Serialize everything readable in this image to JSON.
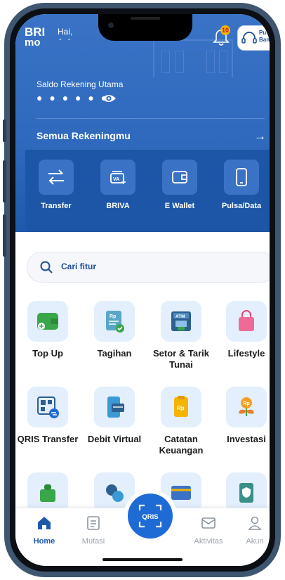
{
  "header": {
    "logo_top": "BRI",
    "logo_bottom": "mo",
    "greeting": "Hai,",
    "user_name": "- -",
    "notification_count": "10",
    "help_label_line1": "Pusa",
    "help_label_line2": "Bantu"
  },
  "balance": {
    "label": "Saldo Rekening Utama",
    "masked_value": "● ● ● ● ● ●",
    "all_accounts_label": "Semua Rekeningmu"
  },
  "quick_actions": [
    {
      "label": "Transfer",
      "icon": "transfer-arrows-icon"
    },
    {
      "label": "BRIVA",
      "icon": "briva-va-icon"
    },
    {
      "label": "E Wallet",
      "icon": "wallet-icon"
    },
    {
      "label": "Pulsa/Data",
      "icon": "phone-icon"
    }
  ],
  "search": {
    "placeholder": "Cari fitur"
  },
  "features": [
    {
      "label": "Top Up",
      "icon": "wallet-topup-icon"
    },
    {
      "label": "Tagihan",
      "icon": "bill-icon"
    },
    {
      "label": "Setor & Tarik Tunai",
      "icon": "atm-icon"
    },
    {
      "label": "Lifestyle",
      "icon": "shopping-bag-icon"
    },
    {
      "label": "QRIS Transfer",
      "icon": "qr-transfer-icon"
    },
    {
      "label": "Debit Virtual",
      "icon": "virtual-debit-icon"
    },
    {
      "label": "Catatan Keuangan",
      "icon": "finance-notes-icon"
    },
    {
      "label": "Investasi",
      "icon": "investment-icon"
    }
  ],
  "bottom_nav": {
    "home": "Home",
    "mutasi": "Mutasi",
    "qris": "QRIS",
    "aktivitas": "Aktivitas",
    "akun": "Akun"
  },
  "colors": {
    "primary": "#1e5aab",
    "header": "#3a73c6",
    "accent": "#f4b400"
  }
}
